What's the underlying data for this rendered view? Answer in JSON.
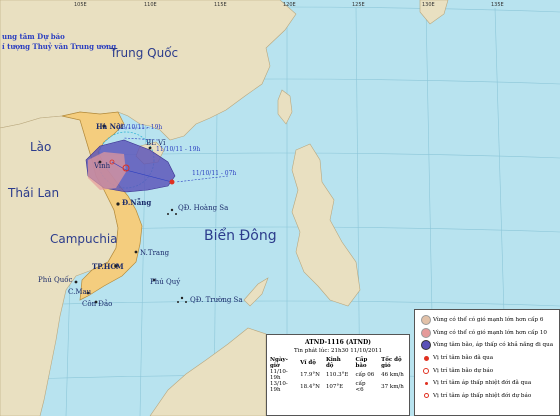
{
  "agency": {
    "line1": "ung tâm Dự báo",
    "line2": "í tượng Thuỷ văn Trung ương"
  },
  "longitudes": [
    "105E",
    "110E",
    "115E",
    "120E",
    "125E",
    "130E",
    "135E"
  ],
  "labels": {
    "trung_quoc": "Trung Quốc",
    "lao": "Lào",
    "thai_lan": "Thái Lan",
    "campuchia": "Campuchia",
    "bien_dong": "Biển Đông",
    "ha_noi": "Hà Nội",
    "vinh": "Vinh",
    "bach_long_vi": "BL Vĩ",
    "da_nang": "Đ.Nẵng",
    "hoang_sa": "QĐ. Hoàng Sa",
    "nha_trang": "N.Trang",
    "tp_hcm": "TP.HCM",
    "phu_quoc": "Phú Quốc",
    "ca_mau": "C.Mau",
    "con_dao": "Côn Đảo",
    "phu_quy": "Phú Quý",
    "truong_sa": "QĐ. Trường Sa"
  },
  "track_labels": {
    "t1": "13/10/11 - 19h",
    "t2": "11/10/11 - 19h",
    "t3": "11/10/11 - 07h"
  },
  "info_box": {
    "title": "ATND-1116 (ATND)",
    "issued": "Tin phát lúc: 21h30 11/10/2011",
    "headers": [
      "Ngày-giờ",
      "Vĩ độ",
      "Kinh độ",
      "Cấp bão",
      "Tốc độ gió"
    ],
    "rows": [
      [
        "11/10-19h",
        "17.9°N",
        "110.3°E",
        "cấp 06",
        "46 km/h"
      ],
      [
        "13/10-19h",
        "18.4°N",
        "107°E",
        "cấp <6",
        "37 km/h"
      ]
    ]
  },
  "legend": [
    {
      "label": "Vùng có thể có gió mạnh lớn hơn cấp 6",
      "symbol": "circle-tan"
    },
    {
      "label": "Vùng có thể có gió mạnh lớn hơn cấp 10",
      "symbol": "circle-pink"
    },
    {
      "label": "Vùng tâm bão, áp thấp có khả năng đi qua",
      "symbol": "circle-purple"
    },
    {
      "label": "Vị trí tâm bão đã qua",
      "symbol": "storm-red"
    },
    {
      "label": "Vị trí tâm bão dự báo",
      "symbol": "storm-outline"
    },
    {
      "label": "Vị trí tâm áp thấp nhiệt đới đã qua",
      "symbol": "dot-red"
    },
    {
      "label": "Vị trí tâm áp thấp nhiệt đới dự báo",
      "symbol": "dot-outline"
    }
  ],
  "colors": {
    "sea": "#b8e3ef",
    "land": "#e9e0c1",
    "vietnam": "#f4cd7e",
    "cone": "#5a52b8",
    "wind6": "#e2c1a8",
    "wind10": "#e59a9a",
    "track": "#2b3ec0"
  }
}
